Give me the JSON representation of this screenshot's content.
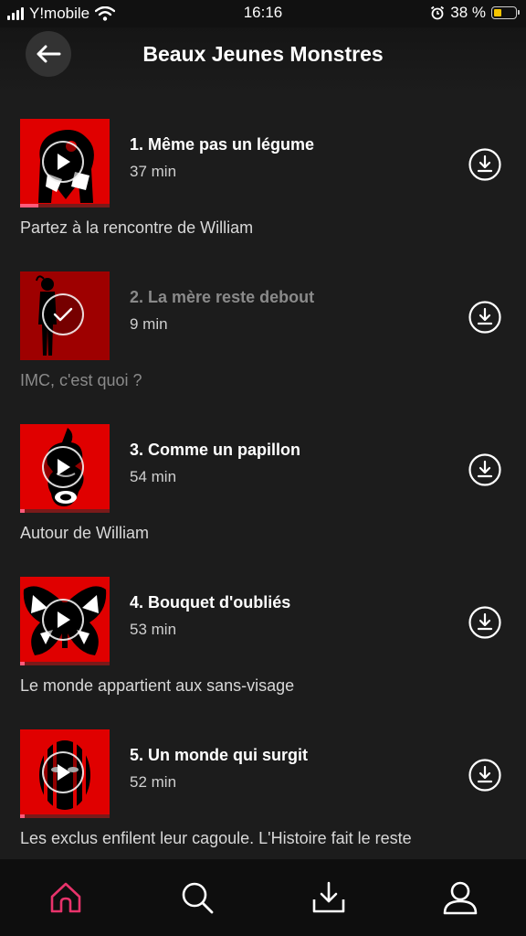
{
  "status_bar": {
    "carrier": "Y!mobile",
    "time": "16:16",
    "battery_percent": "38 %",
    "battery_level": 0.38
  },
  "header": {
    "title": "Beaux Jeunes Monstres",
    "back_icon": "arrow-left-icon"
  },
  "episodes": [
    {
      "title": "1. Même pas un légume",
      "duration": "37 min",
      "description": "Partez à la rencontre de William",
      "state": "play",
      "progress": 0.2,
      "status_icon": "play-icon"
    },
    {
      "title": "2. La mère reste debout",
      "duration": "9 min",
      "description": "IMC, c'est quoi ?",
      "state": "played",
      "progress": 0,
      "status_icon": "check-icon"
    },
    {
      "title": "3. Comme un papillon",
      "duration": "54 min",
      "description": "Autour de William",
      "state": "play",
      "progress": 0.05,
      "status_icon": "play-icon"
    },
    {
      "title": "4. Bouquet d'oubliés",
      "duration": "53 min",
      "description": "Le monde appartient aux sans-visage",
      "state": "play",
      "progress": 0.05,
      "status_icon": "play-icon"
    },
    {
      "title": "5. Un monde qui surgit",
      "duration": "52 min",
      "description": "Les exclus enfilent leur cagoule. L'Histoire fait le reste",
      "state": "play",
      "progress": 0.05,
      "status_icon": "play-icon"
    }
  ],
  "bottom_nav": [
    {
      "icon": "home-icon",
      "active": true,
      "active_color": "#e8336b"
    },
    {
      "icon": "search-icon",
      "active": false
    },
    {
      "icon": "download-tray-icon",
      "active": false
    },
    {
      "icon": "profile-icon",
      "active": false
    }
  ]
}
